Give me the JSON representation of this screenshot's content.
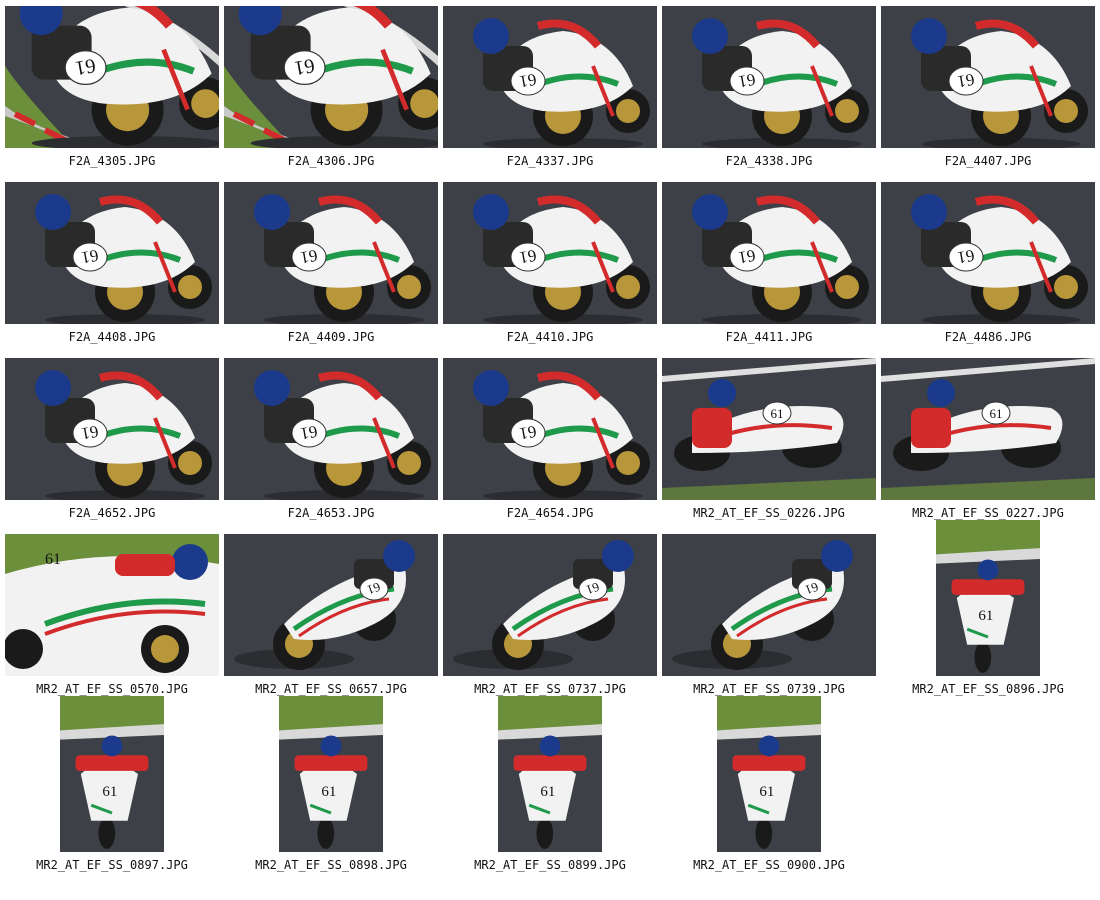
{
  "thumbnails": [
    {
      "name": "F2A_4305.JPG",
      "orientation": "landscape",
      "scene": "curb"
    },
    {
      "name": "F2A_4306.JPG",
      "orientation": "landscape",
      "scene": "curb"
    },
    {
      "name": "F2A_4337.JPG",
      "orientation": "landscape",
      "scene": "lean-left"
    },
    {
      "name": "F2A_4338.JPG",
      "orientation": "landscape",
      "scene": "lean-left"
    },
    {
      "name": "F2A_4407.JPG",
      "orientation": "landscape",
      "scene": "lean-left"
    },
    {
      "name": "F2A_4408.JPG",
      "orientation": "landscape",
      "scene": "lean-left"
    },
    {
      "name": "F2A_4409.JPG",
      "orientation": "landscape",
      "scene": "lean-left"
    },
    {
      "name": "F2A_4410.JPG",
      "orientation": "landscape",
      "scene": "lean-left"
    },
    {
      "name": "F2A_4411.JPG",
      "orientation": "landscape",
      "scene": "lean-left"
    },
    {
      "name": "F2A_4486.JPG",
      "orientation": "landscape",
      "scene": "lean-left"
    },
    {
      "name": "F2A_4652.JPG",
      "orientation": "landscape",
      "scene": "lean-left"
    },
    {
      "name": "F2A_4653.JPG",
      "orientation": "landscape",
      "scene": "lean-left"
    },
    {
      "name": "F2A_4654.JPG",
      "orientation": "landscape",
      "scene": "lean-left"
    },
    {
      "name": "MR2_AT_EF_SS_0226.JPG",
      "orientation": "landscape",
      "scene": "side"
    },
    {
      "name": "MR2_AT_EF_SS_0227.JPG",
      "orientation": "landscape",
      "scene": "side"
    },
    {
      "name": "MR2_AT_EF_SS_0570.JPG",
      "orientation": "landscape",
      "scene": "closeup"
    },
    {
      "name": "MR2_AT_EF_SS_0657.JPG",
      "orientation": "landscape",
      "scene": "lean-right"
    },
    {
      "name": "MR2_AT_EF_SS_0737.JPG",
      "orientation": "landscape",
      "scene": "lean-right"
    },
    {
      "name": "MR2_AT_EF_SS_0739.JPG",
      "orientation": "landscape",
      "scene": "lean-right"
    },
    {
      "name": "MR2_AT_EF_SS_0896.JPG",
      "orientation": "portrait",
      "scene": "head-on"
    },
    {
      "name": "MR2_AT_EF_SS_0897.JPG",
      "orientation": "portrait",
      "scene": "head-on"
    },
    {
      "name": "MR2_AT_EF_SS_0898.JPG",
      "orientation": "portrait",
      "scene": "head-on"
    },
    {
      "name": "MR2_AT_EF_SS_0899.JPG",
      "orientation": "portrait",
      "scene": "head-on"
    },
    {
      "name": "MR2_AT_EF_SS_0900.JPG",
      "orientation": "portrait",
      "scene": "head-on"
    }
  ],
  "bike_number": "61",
  "colors": {
    "asphalt": "#3d4046",
    "fairing": "#f2f2f2",
    "stripe_green": "#1f9a4a",
    "stripe_red": "#d32b2b",
    "helmet": "#1b3a8c",
    "grass": "#6b8f3a"
  }
}
